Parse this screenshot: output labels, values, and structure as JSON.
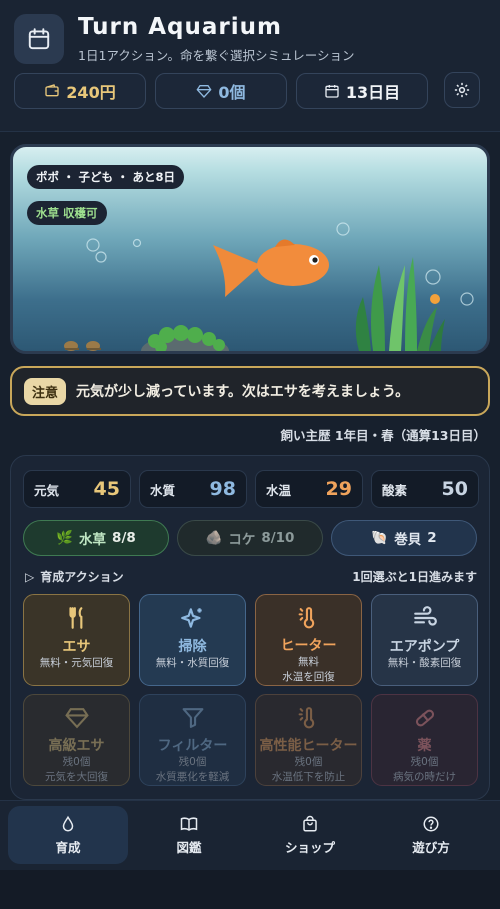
{
  "app": {
    "title": "Turn Aquarium",
    "subtitle": "1日1アクション。命を繋ぐ選択シミュレーション"
  },
  "stats": {
    "money": "240円",
    "gems": "0個",
    "day": "13日目"
  },
  "tank": {
    "fish_status": "ポポ ・ 子ども ・ あと8日",
    "plant_status": "水草 収穫可"
  },
  "notice": {
    "badge": "注意",
    "text": "元気が少し減っています。次はエサを考えましょう。"
  },
  "history": "飼い主歴 1年目・春（通算13日目）",
  "metrics": [
    {
      "label": "元気",
      "value": "45",
      "color": "#e8c77a"
    },
    {
      "label": "水質",
      "value": "98",
      "color": "#8fb9e0"
    },
    {
      "label": "水温",
      "value": "29",
      "color": "#f0a35c"
    },
    {
      "label": "酸素",
      "value": "50",
      "color": "#c8d4e2"
    }
  ],
  "environment": [
    {
      "label": "水草",
      "count": "8/8"
    },
    {
      "label": "コケ",
      "count": "8/10"
    },
    {
      "label": "巻貝",
      "count": "2"
    }
  ],
  "actions_header": {
    "title": "育成アクション",
    "hint": "1回選ぶと1日進みます"
  },
  "actions": [
    {
      "name": "エサ",
      "desc1": "無料・元気回復",
      "desc2": ""
    },
    {
      "name": "掃除",
      "desc1": "無料・水質回復",
      "desc2": ""
    },
    {
      "name": "ヒーター",
      "desc1": "無料",
      "desc2": "水温を回復"
    },
    {
      "name": "エアポンプ",
      "desc1": "無料・酸素回復",
      "desc2": ""
    },
    {
      "name": "高級エサ",
      "desc1": "残0個",
      "desc2": "元気を大回復"
    },
    {
      "name": "フィルター",
      "desc1": "残0個",
      "desc2": "水質悪化を軽減"
    },
    {
      "name": "高性能ヒーター",
      "desc1": "残0個",
      "desc2": "水温低下を防止"
    },
    {
      "name": "薬",
      "desc1": "残0個",
      "desc2": "病気の時だけ"
    }
  ],
  "nav": [
    {
      "label": "育成",
      "icon": "drop-icon"
    },
    {
      "label": "図鑑",
      "icon": "book-icon"
    },
    {
      "label": "ショップ",
      "icon": "bag-icon"
    },
    {
      "label": "遊び方",
      "icon": "help-icon"
    }
  ]
}
